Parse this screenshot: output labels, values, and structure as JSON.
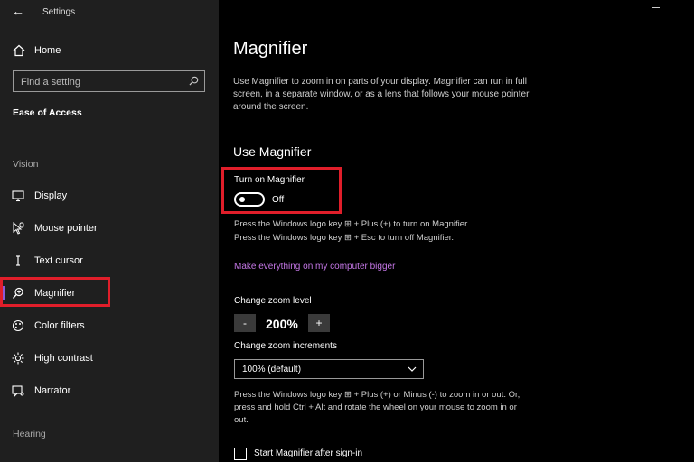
{
  "window": {
    "title": "Settings"
  },
  "sidebar": {
    "home_label": "Home",
    "search_placeholder": "Find a setting",
    "section_title": "Ease of Access",
    "group_vision": "Vision",
    "group_hearing": "Hearing",
    "items": [
      {
        "label": "Display",
        "icon": "display-icon"
      },
      {
        "label": "Mouse pointer",
        "icon": "mouse-pointer-icon"
      },
      {
        "label": "Text cursor",
        "icon": "text-cursor-icon"
      },
      {
        "label": "Magnifier",
        "icon": "magnifier-icon",
        "active": true
      },
      {
        "label": "Color filters",
        "icon": "color-filters-icon"
      },
      {
        "label": "High contrast",
        "icon": "high-contrast-icon"
      },
      {
        "label": "Narrator",
        "icon": "narrator-icon"
      }
    ]
  },
  "main": {
    "title": "Magnifier",
    "description": "Use Magnifier to zoom in on parts of your display. Magnifier can run in full screen, in a separate window, or as a lens that follows your mouse pointer around the screen.",
    "use_heading": "Use Magnifier",
    "toggle_label": "Turn on Magnifier",
    "toggle_state": "Off",
    "hint_line1": "Press the Windows logo key ⊞ + Plus (+) to turn on Magnifier.",
    "hint_line2": "Press the Windows logo key ⊞ + Esc to turn off Magnifier.",
    "link_text": "Make everything on my computer bigger",
    "zoom_level_label": "Change zoom level",
    "zoom_minus": "-",
    "zoom_value": "200%",
    "zoom_plus": "+",
    "zoom_increments_label": "Change zoom increments",
    "zoom_increments_value": "100% (default)",
    "zoom_hint": "Press the Windows logo key ⊞ + Plus (+) or Minus (-) to zoom in or out. Or, press and hold Ctrl + Alt and rotate the wheel on your mouse to zoom in or out.",
    "start_after_signin_label": "Start Magnifier after sign-in"
  },
  "colors": {
    "highlight_box": "#e01e2a",
    "accent": "#8a5ad8",
    "link": "#c678e8"
  }
}
